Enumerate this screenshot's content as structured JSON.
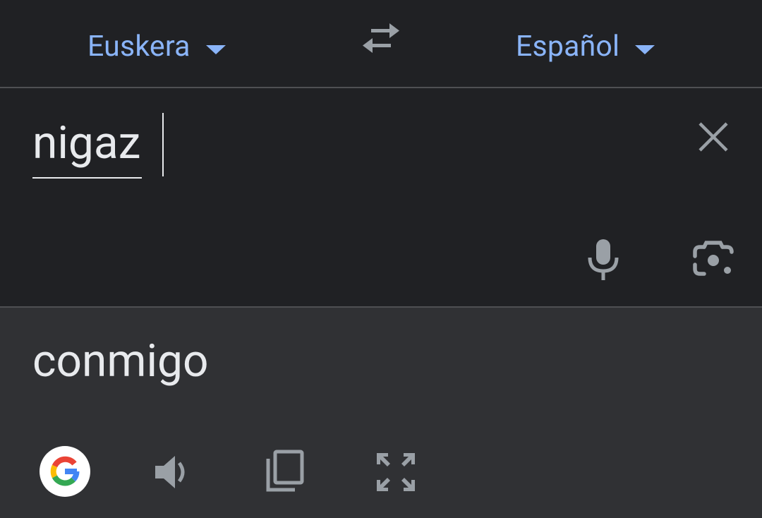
{
  "language_bar": {
    "source_language": "Euskera",
    "target_language": "Español",
    "swap_icon": "swap-arrows-icon"
  },
  "input": {
    "text": "nigaz",
    "clear_icon": "close-icon",
    "mic_icon": "microphone-icon",
    "camera_icon": "camera-lens-icon"
  },
  "output": {
    "text": "conmigo",
    "icons": [
      "google-logo-icon",
      "speaker-icon",
      "copy-icon",
      "fullscreen-icon"
    ]
  },
  "colors": {
    "background": "#202124",
    "output_background": "#303134",
    "accent": "#8ab4f8",
    "text": "#e8eaed",
    "icon": "#9aa0a6",
    "divider": "#4f5053"
  }
}
